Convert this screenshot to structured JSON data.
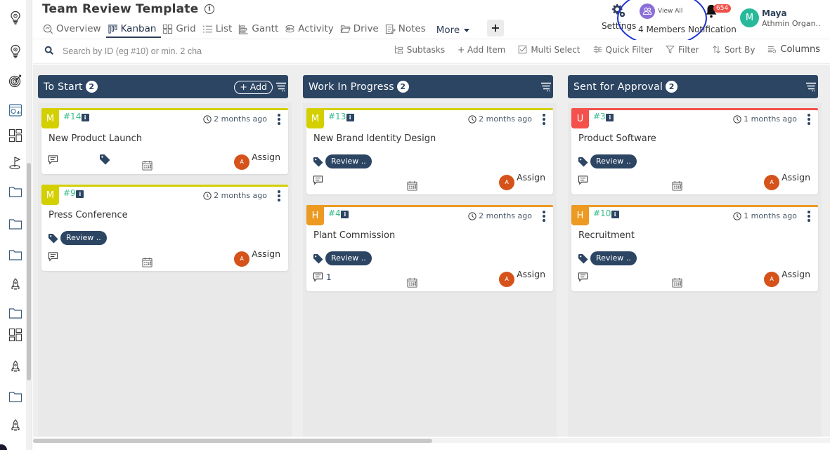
{
  "header": {
    "title": "Team Review Template",
    "tabs": [
      {
        "label": "Overview",
        "icon": "overview-icon",
        "active": false
      },
      {
        "label": "Kanban",
        "icon": "kanban-icon",
        "active": true
      },
      {
        "label": "Grid",
        "icon": "grid-icon",
        "active": false
      },
      {
        "label": "List",
        "icon": "list-icon",
        "active": false
      },
      {
        "label": "Gantt",
        "icon": "gantt-icon",
        "active": false
      },
      {
        "label": "Activity",
        "icon": "activity-icon",
        "active": false
      },
      {
        "label": "Drive",
        "icon": "drive-icon",
        "active": false
      },
      {
        "label": "Notes",
        "icon": "notes-icon",
        "active": false
      }
    ],
    "more_label": "More",
    "add_tab_label": "+",
    "settings_label": "Settings",
    "members_view_all": "View All",
    "members_label": "4 Members",
    "notification_label": "Notification",
    "notification_count": "654",
    "user": {
      "initial": "M",
      "name": "Maya",
      "org": "Athmin Organ.."
    }
  },
  "toolbar": {
    "search_placeholder": "Search by ID (eg #10) or min. 2 cha",
    "tools": [
      "Subtasks",
      "+ Add Item",
      "Multi Select",
      "Quick Filter",
      "Filter",
      "Sort By",
      "Columns"
    ]
  },
  "columns": [
    {
      "title": "To Start",
      "count": "2",
      "add_label": "+ Add",
      "cards": [
        {
          "priority": "M",
          "priority_color": "#d4d000",
          "id": "#14",
          "time": "2 months ago",
          "name": "New Product Launch",
          "tag": "",
          "comments": "",
          "assign": "Assign",
          "assignee_initial": "A"
        },
        {
          "priority": "M",
          "priority_color": "#d4d000",
          "id": "#9",
          "time": "2 months ago",
          "name": "Press Conference",
          "tag": "Review ..",
          "comments": "",
          "assign": "Assign",
          "assignee_initial": "A"
        }
      ]
    },
    {
      "title": "Work In Progress",
      "count": "2",
      "add_label": "",
      "cards": [
        {
          "priority": "M",
          "priority_color": "#d4d000",
          "id": "#13",
          "time": "2 months ago",
          "name": "New Brand Identity Design",
          "tag": "Review ..",
          "comments": "",
          "assign": "Assign",
          "assignee_initial": "A"
        },
        {
          "priority": "H",
          "priority_color": "#ec9a22",
          "id": "#4",
          "time": "2 months ago",
          "name": "Plant Commission",
          "tag": "Review ..",
          "comments": "1",
          "assign": "Assign",
          "assignee_initial": "A"
        }
      ]
    },
    {
      "title": "Sent for Approval",
      "count": "2",
      "add_label": "",
      "cards": [
        {
          "priority": "U",
          "priority_color": "#f4504c",
          "id": "#3",
          "time": "1 months ago",
          "name": "Product Software",
          "tag": "Review ..",
          "comments": "",
          "assign": "Assign",
          "assignee_initial": "A"
        },
        {
          "priority": "H",
          "priority_color": "#ec9a22",
          "id": "#10",
          "time": "1 months ago",
          "name": "Recruitment",
          "tag": "Review ..",
          "comments": "",
          "assign": "Assign",
          "assignee_initial": "A"
        }
      ]
    }
  ],
  "sidebar_icons": [
    "lightbulb-icon",
    "lightbulb-icon",
    "target-icon",
    "dashboard-icon",
    "layout-icon",
    "golf-flag-icon",
    "folder-icon",
    "folder-icon",
    "folder-icon",
    "rocket-icon",
    "folder-icon",
    "layout-icon",
    "rocket-icon",
    "folder-icon",
    "rocket-icon"
  ],
  "colors": {
    "primary": "#2c4563",
    "accent_green": "#3bbf8c",
    "medium": "#d4d000",
    "high": "#ec9a22",
    "urgent": "#f4504c",
    "assignee": "#d5531a"
  }
}
